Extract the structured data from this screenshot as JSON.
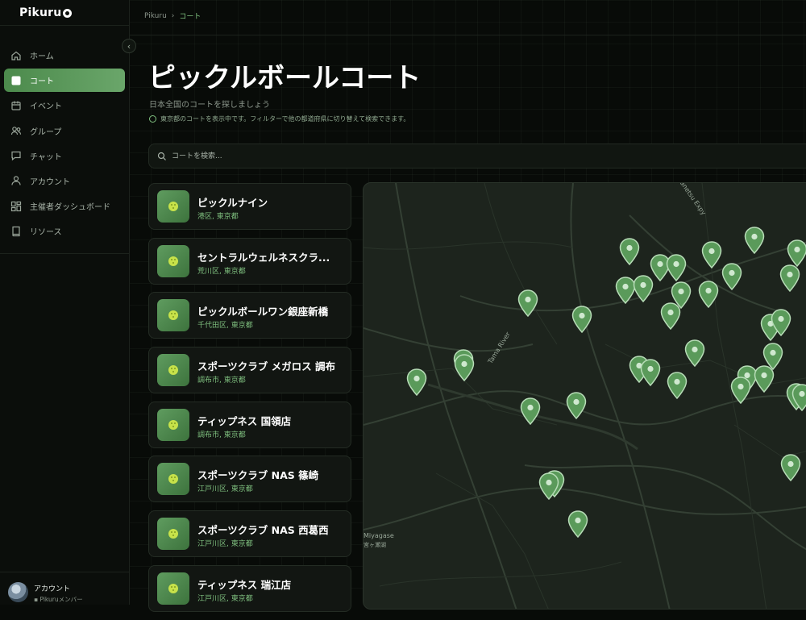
{
  "app": {
    "logo": "Pikuru"
  },
  "sidebar": {
    "items": [
      {
        "label": "ホーム",
        "icon": "home-icon",
        "active": false
      },
      {
        "label": "コート",
        "icon": "court-icon",
        "active": true
      },
      {
        "label": "イベント",
        "icon": "calendar-icon",
        "active": false
      },
      {
        "label": "グループ",
        "icon": "users-icon",
        "active": false
      },
      {
        "label": "チャット",
        "icon": "chat-icon",
        "active": false
      },
      {
        "label": "アカウント",
        "icon": "user-icon",
        "active": false
      },
      {
        "label": "主催者ダッシュボード",
        "icon": "dashboard-icon",
        "active": false
      },
      {
        "label": "リソース",
        "icon": "book-icon",
        "active": false
      }
    ],
    "collapse_icon": "chevron-left-icon",
    "account": {
      "name": "アカウント",
      "role": "Pikuruメンバー"
    }
  },
  "breadcrumb": {
    "root": "Pikuru",
    "separator": "›",
    "current": "コート"
  },
  "page": {
    "title": "ピックルボールコート",
    "subtitle": "日本全国のコートを探しましょう",
    "info": "東京都のコートを表示中です。フィルターで他の都道府県に切り替えて検索できます。"
  },
  "search": {
    "placeholder": "コートを検索...",
    "value": ""
  },
  "courts": [
    {
      "name": "ピックルナイン",
      "location": "港区, 東京都"
    },
    {
      "name": "セントラルウェルネスクラ...",
      "location": "荒川区, 東京都"
    },
    {
      "name": "ピックルボールワン銀座新橋",
      "location": "千代田区, 東京都"
    },
    {
      "name": "スポーツクラブ メガロス 調布",
      "location": "調布市, 東京都"
    },
    {
      "name": "ティップネス 国領店",
      "location": "調布市, 東京都"
    },
    {
      "name": "スポーツクラブ NAS 篠崎",
      "location": "江戸川区, 東京都"
    },
    {
      "name": "スポーツクラブ NAS 西葛西",
      "location": "江戸川区, 東京都"
    },
    {
      "name": "ティップネス 瑞江店",
      "location": "江戸川区, 東京都"
    }
  ],
  "map": {
    "labels": {
      "road1": "Tama River",
      "place1": "Miyagase",
      "place1_jp": "宮ヶ瀬湖",
      "road2": "Kanetsu Expy"
    }
  },
  "colors": {
    "accent": "#6aa66a",
    "background": "#080b08",
    "location_text": "#7fc07f"
  }
}
